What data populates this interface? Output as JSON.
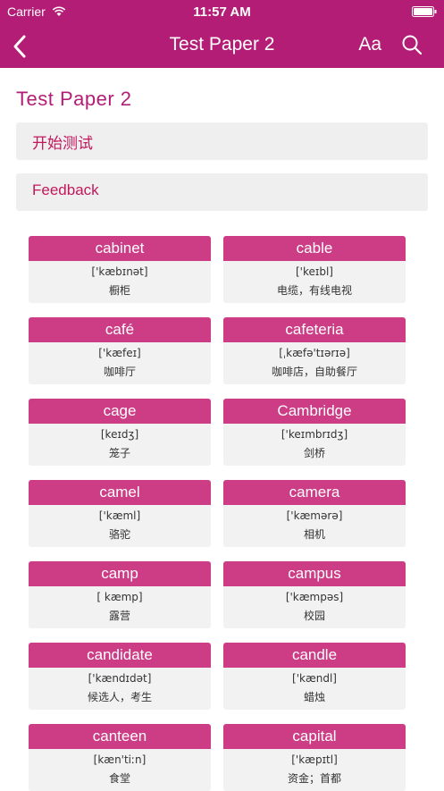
{
  "status_bar": {
    "carrier": "Carrier",
    "time": "11:57 AM"
  },
  "nav": {
    "title": "Test Paper 2",
    "font_button": "Aa"
  },
  "page": {
    "title": "Test Paper 2"
  },
  "actions": {
    "start_test": "开始测试",
    "feedback": "Feedback"
  },
  "colors": {
    "brand": "#b31d75",
    "card_header": "#cc3d86",
    "action_text": "#c2185b"
  },
  "icons": [
    "wifi-icon",
    "battery-icon",
    "back-icon",
    "search-icon"
  ],
  "words": [
    {
      "word": "cabinet",
      "phonetic": "['kæbɪnət]",
      "meaning": "橱柜"
    },
    {
      "word": "cable",
      "phonetic": "['keɪbl]",
      "meaning": "电缆，有线电视"
    },
    {
      "word": "café",
      "phonetic": "['kæfeɪ]",
      "meaning": "咖啡厅"
    },
    {
      "word": "cafeteria",
      "phonetic": "[ˌkæfə'tɪərɪə]",
      "meaning": "咖啡店，自助餐厅"
    },
    {
      "word": "cage",
      "phonetic": "[keɪdʒ]",
      "meaning": "笼子"
    },
    {
      "word": "Cambridge",
      "phonetic": "['keɪmbrɪdʒ]",
      "meaning": "剑桥"
    },
    {
      "word": "camel",
      "phonetic": "['kæml]",
      "meaning": "骆驼"
    },
    {
      "word": "camera",
      "phonetic": "['kæmərə]",
      "meaning": "相机"
    },
    {
      "word": "camp",
      "phonetic": "[ kæmp]",
      "meaning": "露营"
    },
    {
      "word": "campus",
      "phonetic": "['kæmpəs]",
      "meaning": "校园"
    },
    {
      "word": "candidate",
      "phonetic": "['kændɪdət]",
      "meaning": "候选人，考生"
    },
    {
      "word": "candle",
      "phonetic": "['kændl]",
      "meaning": "蜡烛"
    },
    {
      "word": "canteen",
      "phonetic": "[kæn'tiːn]",
      "meaning": "食堂"
    },
    {
      "word": "capital",
      "phonetic": "['kæpɪtl]",
      "meaning": "资金；首都"
    }
  ]
}
